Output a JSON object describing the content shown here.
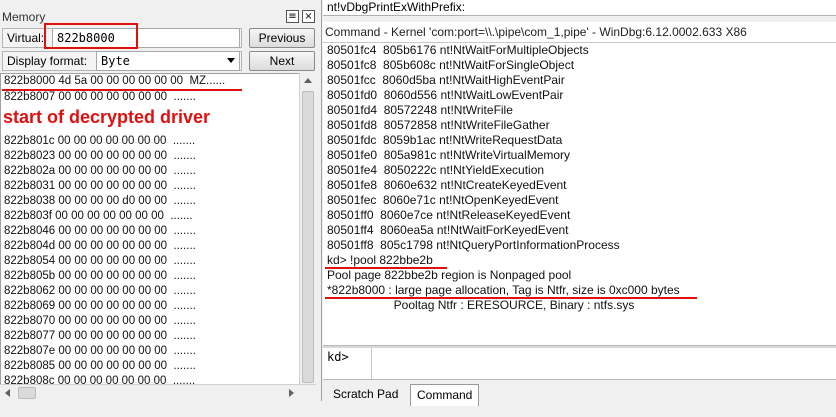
{
  "memory": {
    "title": "Memory",
    "virtual_label": "Virtual:",
    "virtual_value": "822b8000",
    "previous_button": "Previous",
    "display_format_label": "Display format:",
    "display_format_value": "Byte",
    "next_button": "Next",
    "annotation": "start of decrypted driver",
    "lines": [
      "822b8000 4d 5a 00 00 00 00 00 00  MZ......",
      "822b8007 00 00 00 00 00 00 00  .......",
      "822b801c 00 00 00 00 00 00 00  .......",
      "822b8023 00 00 00 00 00 00 00  .......",
      "822b802a 00 00 00 00 00 00 00  .......",
      "822b8031 00 00 00 00 00 00 00  .......",
      "822b8038 00 00 00 00 d0 00 00  .......",
      "822b803f 00 00 00 00 00 00 00  .......",
      "822b8046 00 00 00 00 00 00 00  .......",
      "822b804d 00 00 00 00 00 00 00  .......",
      "822b8054 00 00 00 00 00 00 00  .......",
      "822b805b 00 00 00 00 00 00 00  .......",
      "822b8062 00 00 00 00 00 00 00  .......",
      "822b8069 00 00 00 00 00 00 00  .......",
      "822b8070 00 00 00 00 00 00 00  .......",
      "822b8077 00 00 00 00 00 00 00  .......",
      "822b807e 00 00 00 00 00 00 00  .......",
      "822b8085 00 00 00 00 00 00 00  .......",
      "822b808c 00 00 00 00 00 00 00  ......."
    ]
  },
  "top_strip": "nt!vDbgPrintExWithPrefix:",
  "command": {
    "title": "Command - Kernel 'com:port=\\\\.\\pipe\\com_1,pipe' - WinDbg:6.12.0002.633 X86",
    "output": [
      "80501fc4  805b6176 nt!NtWaitForMultipleObjects",
      "80501fc8  805b608c nt!NtWaitForSingleObject",
      "80501fcc  8060d5ba nt!NtWaitHighEventPair",
      "80501fd0  8060d556 nt!NtWaitLowEventPair",
      "80501fd4  80572248 nt!NtWriteFile",
      "80501fd8  80572858 nt!NtWriteFileGather",
      "80501fdc  8059b1ac nt!NtWriteRequestData",
      "80501fe0  805a981c nt!NtWriteVirtualMemory",
      "80501fe4  8050222c nt!NtYieldExecution",
      "80501fe8  8060e632 nt!NtCreateKeyedEvent",
      "80501fec  8060e71c nt!NtOpenKeyedEvent",
      "80501ff0  8060e7ce nt!NtReleaseKeyedEvent",
      "80501ff4  8060ea5a nt!NtWaitForKeyedEvent",
      "80501ff8  805c1798 nt!NtQueryPortInformationProcess",
      "kd> !pool 822bbe2b",
      "Pool page 822bbe2b region is Nonpaged pool",
      "*822b8000 : large page allocation, Tag is Ntfr, size is 0xc000 bytes",
      "                    Pooltag Ntfr : ERESOURCE, Binary : ntfs.sys"
    ],
    "prompt": "kd>"
  },
  "tabs": [
    "Scratch Pad",
    "Command"
  ],
  "colors": {
    "annotation_red": "#e01010",
    "window_bg": "#f0f0f0"
  }
}
